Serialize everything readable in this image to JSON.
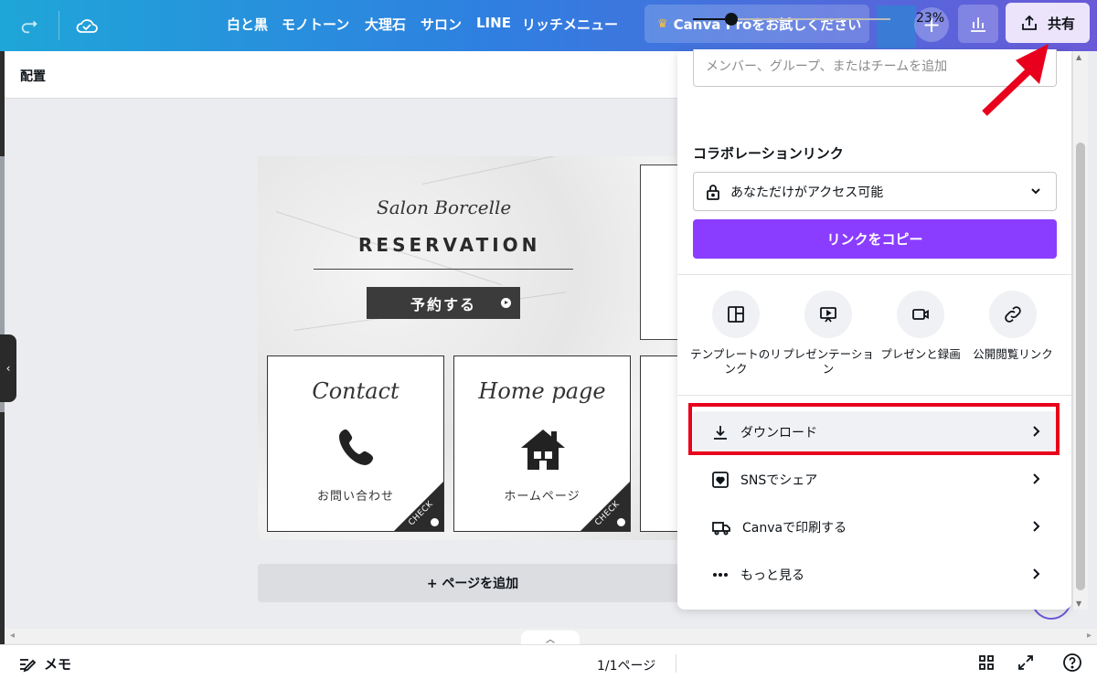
{
  "topbar": {
    "style_tabs": [
      "白と黒",
      "モノトーン",
      "大理石",
      "サロン",
      "LINE",
      "リッチメニュー"
    ],
    "pro_label": "Canva Proをお試しください",
    "plus_label": "+",
    "share_label": "共有"
  },
  "subheader": {
    "arrange_label": "配置"
  },
  "design": {
    "salon_script": "Salon Borcelle",
    "reservation_title": "RESERVATION",
    "reserve_button": "予約する",
    "cards": [
      {
        "title": "Contact",
        "label": "お問い合わせ",
        "icon": "phone-icon",
        "badge": "CHECK"
      },
      {
        "title": "Home page",
        "label": "ホームページ",
        "icon": "house-icon",
        "badge": "CHECK"
      }
    ]
  },
  "add_page_label": "+ ページを追加",
  "bottombar": {
    "memo_label": "メモ",
    "page_count": "1/1ページ",
    "zoom_percent": "23%",
    "zoom_level": 0.23
  },
  "share_panel": {
    "member_placeholder": "メンバー、グループ、またはチームを追加",
    "collab_title": "コラボレーションリンク",
    "access_label": "あなただけがアクセス可能",
    "copy_link_label": "リンクをコピー",
    "quick_actions": [
      {
        "label": "テンプレートのリンク",
        "icon": "template-icon"
      },
      {
        "label": "プレゼンテーション",
        "icon": "presentation-icon"
      },
      {
        "label": "プレゼンと録画",
        "icon": "video-record-icon"
      },
      {
        "label": "公開閲覧リンク",
        "icon": "link-icon"
      }
    ],
    "rows": [
      {
        "label": "ダウンロード",
        "icon": "download-icon"
      },
      {
        "label": "SNSでシェア",
        "icon": "heart-icon"
      },
      {
        "label": "Canvaで印刷する",
        "icon": "truck-icon"
      },
      {
        "label": "もっと見る",
        "icon": "more-icon"
      }
    ]
  },
  "colors": {
    "accent_purple": "#8b3dff",
    "highlight_red": "#e8001c",
    "topbar_gradient_start": "#1fa6d8",
    "topbar_gradient_end": "#6a5ad8"
  }
}
